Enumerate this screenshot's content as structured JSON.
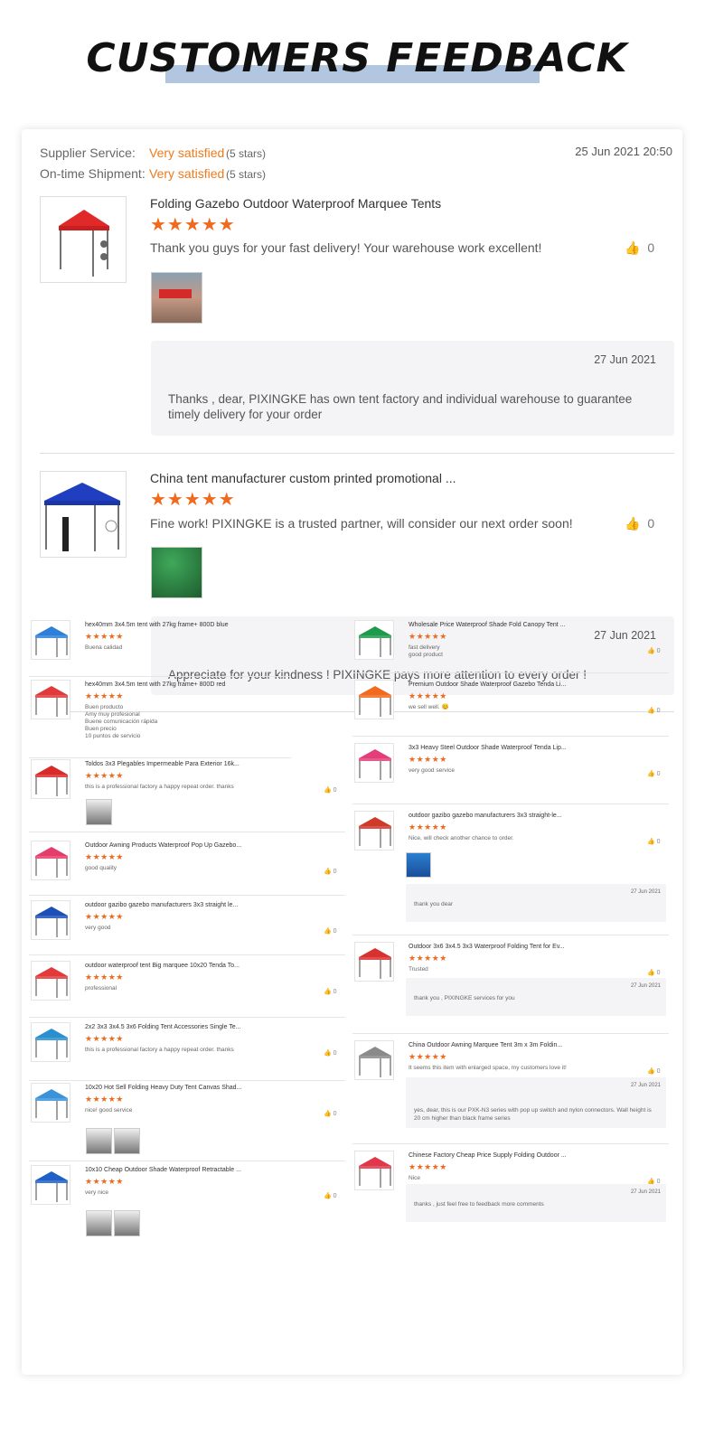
{
  "heading": "CUSTOMERS FEEDBACK",
  "summary": {
    "supplier_label": "Supplier Service:",
    "supplier_value": "Very satisfied",
    "supplier_stars": "(5 stars)",
    "shipment_label": "On-time Shipment:",
    "shipment_value": "Very satisfied",
    "shipment_stars": "(5 stars)",
    "date": "25 Jun 2021 20:50"
  },
  "reviews": [
    {
      "title": "Folding Gazebo Outdoor Waterproof Marquee Tents",
      "stars": "★★★★★",
      "text": "Thank you guys for your fast delivery! Your warehouse work excellent!",
      "likes": "0",
      "reply_date": "27 Jun 2021",
      "reply": "Thanks , dear,   PIXINGKE has own tent factory and individual warehouse to guarantee timely delivery for your order"
    },
    {
      "title": "China tent manufacturer custom printed promotional ...",
      "stars": "★★★★★",
      "text": "Fine work!  PIXINGKE is a trusted partner,  will consider our next order soon!",
      "likes": "0",
      "reply_date": "27 Jun 2021",
      "reply": "Appreciate for your kindness ! PIXINGKE pays more attention to every order !"
    }
  ],
  "left_reviews": [
    {
      "title": "hex40mm 3x4.5m tent with 27kg frame+ 800D blue",
      "stars": "★★★★★",
      "text": "Buena calidad",
      "likes": "",
      "color": "#2d7fd8"
    },
    {
      "title": "hex40mm 3x4.5m tent with 27kg frame+ 800D red",
      "stars": "★★★★★",
      "text": "Buen producto\nAmy muy profesional\nBuene comunicación rápida\nBuen precio\n10 puntos de servicio",
      "likes": "",
      "color": "#e03a3a"
    },
    {
      "title": "Toldos 3x3 Plegables Impermeable Para Exterior 16k...",
      "stars": "★★★★★",
      "text": "this is a professional factory   a happy repeat order.  thanks",
      "likes": "0",
      "color": "#d92a2a"
    },
    {
      "title": "Outdoor Awning Products Waterproof Pop Up Gazebo...",
      "stars": "★★★★★",
      "text": "good quality",
      "likes": "0",
      "color": "#e53c6a"
    },
    {
      "title": "outdoor gazibo gazebo manufacturers 3x3 straight le...",
      "stars": "★★★★★",
      "text": "very good",
      "likes": "0",
      "color": "#1d4fb8"
    },
    {
      "title": "outdoor waterproof tent Big marquee 10x20 Tenda To...",
      "stars": "★★★★★",
      "text": "professional",
      "likes": "0",
      "color": "#e23a3a"
    },
    {
      "title": "2x2 3x3 3x4.5 3x6 Folding Tent Accessories Single Te...",
      "stars": "★★★★★",
      "text": "this is a professional factory   a happy repeat order.  thanks",
      "likes": "0",
      "color": "#2a8fcf"
    },
    {
      "title": "10x20 Hot Sell Folding Heavy Duty Tent Canvas Shad...",
      "stars": "★★★★★",
      "text": "nice! good service",
      "likes": "0",
      "color": "#3a93d9"
    },
    {
      "title": "10x10 Cheap Outdoor Shade Waterproof Retractable ...",
      "stars": "★★★★★",
      "text": "very nice",
      "likes": "0",
      "color": "#1f5fc8"
    }
  ],
  "right_reviews": [
    {
      "title": "Wholesale Price Waterproof Shade Fold Canopy Tent ...",
      "stars": "★★★★★",
      "text": "fast delivery\ngood product",
      "likes": "0",
      "color": "#1f9a4a",
      "reply_date": "",
      "reply": ""
    },
    {
      "title": "Premium Outdoor Shade Waterproof Gazebo Tenda Li...",
      "stars": "★★★★★",
      "text": "we sell well. 😊",
      "likes": "0",
      "color": "#f26a1e",
      "reply_date": "",
      "reply": ""
    },
    {
      "title": "3x3 Heavy Steel Outdoor Shade Waterproof Tenda Lip...",
      "stars": "★★★★★",
      "text": "very good service",
      "likes": "0",
      "color": "#e33d7a",
      "reply_date": "",
      "reply": ""
    },
    {
      "title": "outdoor gazibo gazebo manufacturers 3x3 straight-le...",
      "stars": "★★★★★",
      "text": "Nice, will check another chance to order.",
      "likes": "0",
      "color": "#cf3a2a",
      "reply_date": "27 Jun 2021",
      "reply": "thank you dear"
    },
    {
      "title": "Outdoor 3x6 3x4.5 3x3 Waterproof Folding Tent for Ev...",
      "stars": "★★★★★",
      "text": "Trusted",
      "likes": "0",
      "color": "#d93030",
      "reply_date": "27 Jun 2021",
      "reply": "thank you ,  PIXINGKE services for you"
    },
    {
      "title": "China Outdoor Awning Marquee Tent 3m x 3m Foldin...",
      "stars": "★★★★★",
      "text": "It seems this item with enlarged space,  my customers love it!",
      "likes": "0",
      "color": "#8a8a8a",
      "reply_date": "27 Jun 2021",
      "reply": "yes, dear,  this is our PXK-N3 series with pop up switch and nylon connectors. Wall height is 20 cm higher than black frame series"
    },
    {
      "title": "Chinese Factory Cheap Price Supply Folding Outdoor ...",
      "stars": "★★★★★",
      "text": "Nice",
      "likes": "0",
      "color": "#e0384a",
      "reply_date": "27 Jun 2021",
      "reply": "thanks , just feel free to feedback more comments"
    }
  ],
  "icons": {
    "like": "thumbs-up-icon",
    "star": "star-icon"
  },
  "colors": {
    "accent": "#ee7a1c",
    "star": "#f06a1e",
    "heading_highlight": "#b3c6df"
  }
}
